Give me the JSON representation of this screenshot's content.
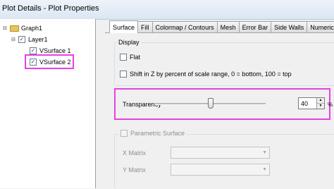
{
  "window": {
    "title": "Plot Details - Plot Properties"
  },
  "tree": {
    "expanders": {
      "graph": "⊟",
      "layer": "⊟"
    },
    "graph": {
      "label": "Graph1"
    },
    "layer": {
      "label": "Layer1",
      "checked": true
    },
    "items": [
      {
        "label": "VSurface 1",
        "checked": true
      },
      {
        "label": "VSurface 2",
        "checked": true,
        "highlighted": true
      }
    ]
  },
  "tabs": [
    {
      "label": "Surface",
      "active": true
    },
    {
      "label": "Fill"
    },
    {
      "label": "Colormap / Contours"
    },
    {
      "label": "Mesh"
    },
    {
      "label": "Error Bar"
    },
    {
      "label": "Side Walls"
    },
    {
      "label": "Numeric"
    }
  ],
  "display": {
    "group_label": "Display",
    "flat_label": "Flat",
    "flat_checked": false,
    "shift_label": "Shift in Z by percent of scale range, 0 = bottom, 100 = top",
    "shift_checked": false
  },
  "transparency": {
    "label": "Transparency",
    "value": "40",
    "slider_percent": 50,
    "unit": "%"
  },
  "parametric": {
    "label": "Parametric Surface",
    "checked": false,
    "x_matrix_label": "X Matrix",
    "y_matrix_label": "Y Matrix",
    "x_matrix_value": "",
    "y_matrix_value": ""
  },
  "icons": {
    "expander": "minus-box-icon",
    "folder": "folder-icon",
    "check": "✓",
    "spin_up": "▲",
    "spin_down": "▼",
    "combo_arrow": "▼"
  },
  "colors": {
    "highlight": "#e640e6",
    "folder": "#e8c45a"
  }
}
